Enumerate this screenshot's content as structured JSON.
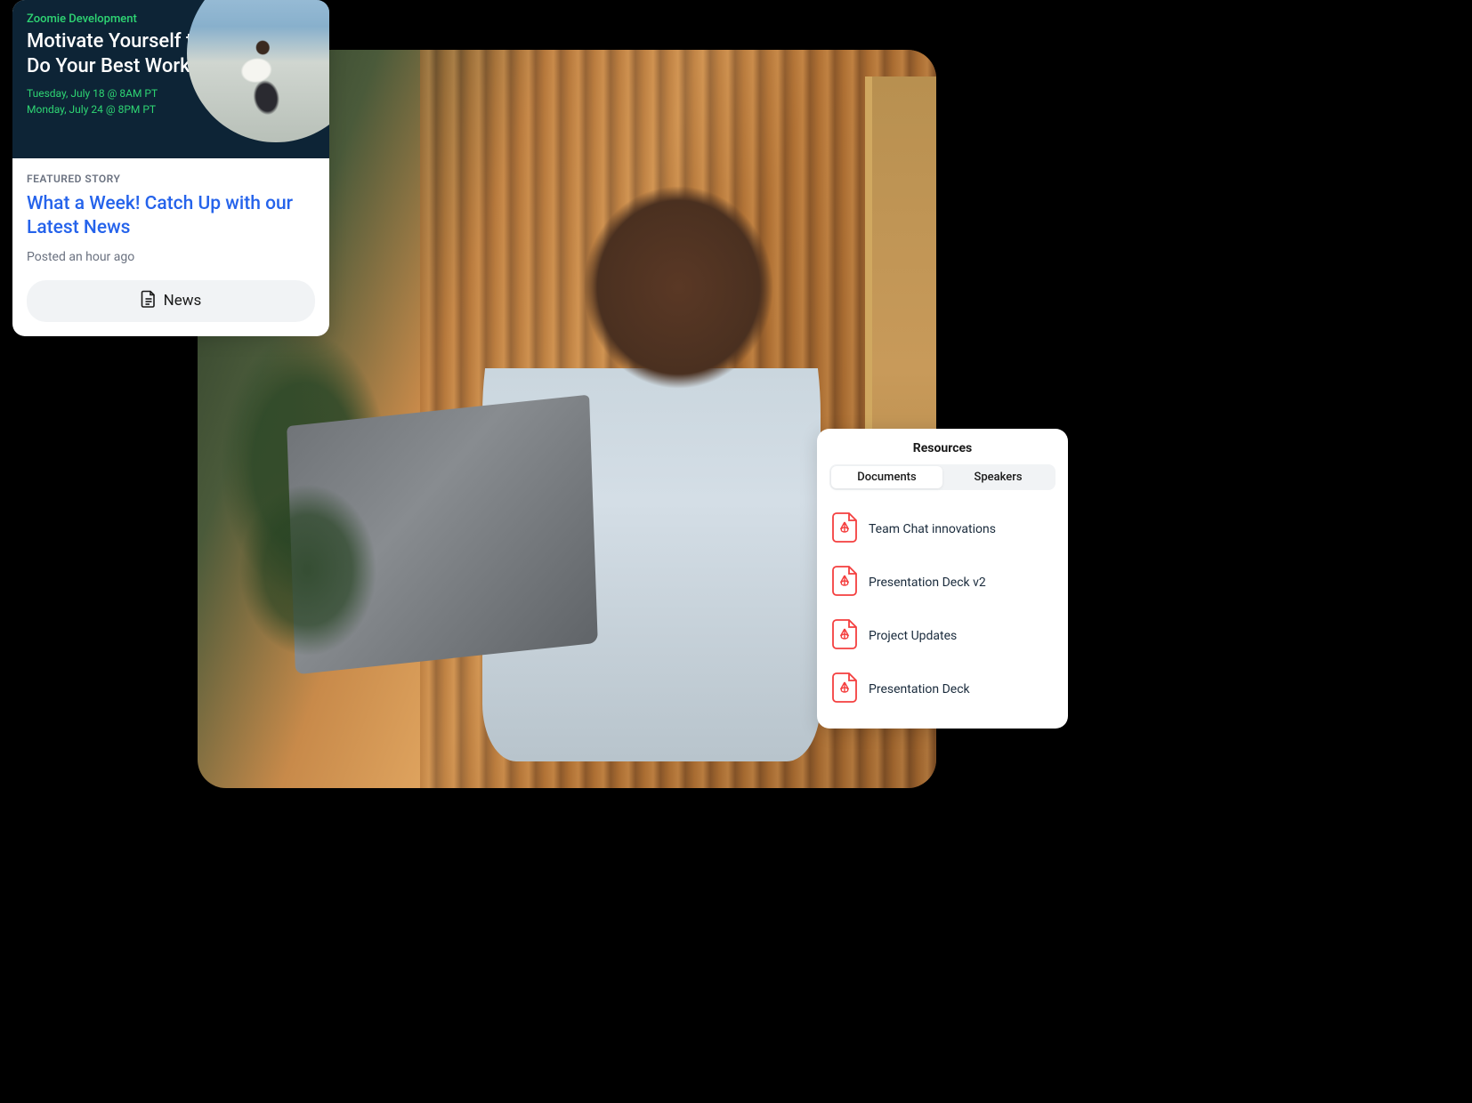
{
  "story": {
    "category": "Zoomie Development",
    "title": "Motivate Yourself to Do Your Best Work",
    "dates": [
      "Tuesday, July 18 @ 8AM PT",
      "Monday, July 24 @ 8PM PT"
    ]
  },
  "featured": {
    "label": "FEATURED STORY",
    "title": "What a Week! Catch Up with our Latest News",
    "posted": "Posted an hour ago",
    "button": "News"
  },
  "resources": {
    "title": "Resources",
    "tabs": [
      {
        "label": "Documents",
        "active": true
      },
      {
        "label": "Speakers",
        "active": false
      }
    ],
    "items": [
      {
        "label": "Team Chat innovations"
      },
      {
        "label": "Presentation Deck v2"
      },
      {
        "label": "Project Updates"
      },
      {
        "label": "Presentation Deck"
      }
    ]
  }
}
